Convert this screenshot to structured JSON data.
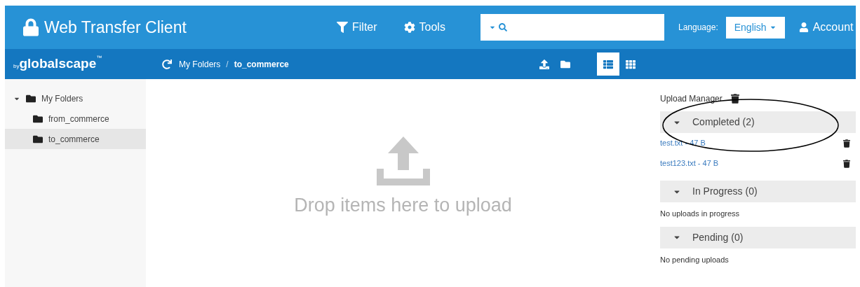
{
  "header": {
    "title": "Web Transfer Client",
    "nav": [
      {
        "label": "Filter",
        "kind": "filter"
      },
      {
        "label": "Tools",
        "kind": "tools"
      }
    ],
    "language_label": "Language:",
    "language": "English",
    "account": "Account"
  },
  "toolbar": {
    "brand_prefix": "by",
    "brand": "globalscape",
    "brand_mark": "™",
    "breadcrumb": [
      {
        "label": "My Folders",
        "current": false
      },
      {
        "label": "to_commerce",
        "current": true
      }
    ],
    "separator": "/",
    "views": [
      {
        "kind": "list",
        "selected": true
      },
      {
        "kind": "grid",
        "selected": false
      }
    ]
  },
  "tree": [
    {
      "label": "My Folders",
      "expanded": true,
      "selected": false,
      "children": [
        {
          "label": "from_commerce",
          "selected": false
        },
        {
          "label": "to_commerce",
          "selected": true
        }
      ]
    }
  ],
  "dropzone": {
    "text": "Drop items here to upload"
  },
  "upload_manager": {
    "title": "Upload Manager",
    "sections": [
      {
        "title": "Completed (2)",
        "expanded": true,
        "highlighted": true,
        "files": [
          "test.txt - 47 B",
          "test123.txt - 47 B"
        ]
      },
      {
        "title": "In Progress (0)",
        "expanded": true,
        "highlighted": false,
        "empty": "No uploads in progress"
      },
      {
        "title": "Pending (0)",
        "expanded": true,
        "highlighted": false,
        "empty": "No pending uploads"
      }
    ]
  }
}
